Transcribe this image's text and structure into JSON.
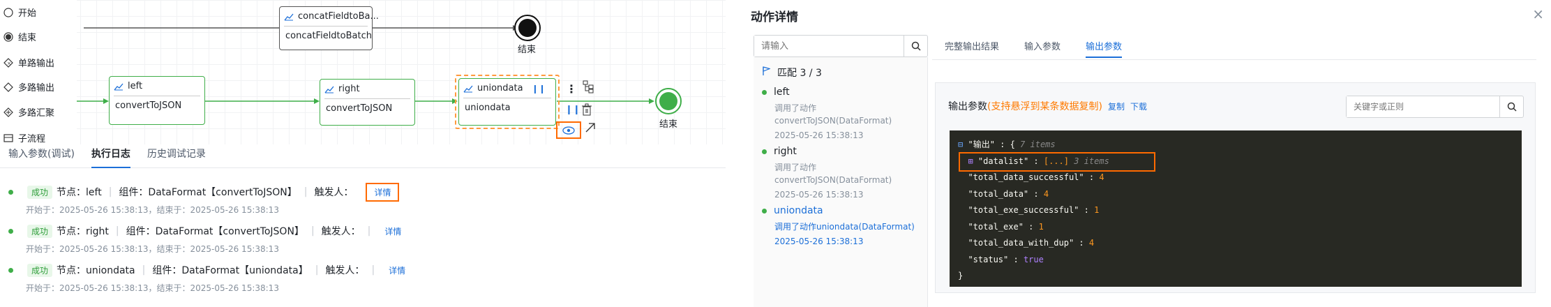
{
  "palette": [
    {
      "label": "开始",
      "icon": "circle-icon"
    },
    {
      "label": "结束",
      "icon": "filled-circle-icon"
    },
    {
      "label": "单路输出",
      "icon": "diamond-icon"
    },
    {
      "label": "多路输出",
      "icon": "diamond-icon"
    },
    {
      "label": "多路汇聚",
      "icon": "diamond-plus-icon"
    },
    {
      "label": "子流程",
      "icon": "subflow-icon"
    }
  ],
  "nodes": {
    "concat": {
      "title": "concatFieldtoBa...",
      "body": "concatFieldtoBatch"
    },
    "left": {
      "title": "left",
      "body": "convertToJSON"
    },
    "right": {
      "title": "right",
      "body": "convertToJSON"
    },
    "uniondata": {
      "title": "uniondata",
      "body": "uniondata"
    }
  },
  "end_labels": [
    "结束",
    "结束"
  ],
  "bottom_tabs": [
    "输入参数(调试)",
    "执行日志",
    "历史调试记录"
  ],
  "logs": [
    {
      "status": "成功",
      "node_label": "节点：",
      "node": "left",
      "comp_label": "组件：",
      "comp": "DataFormat【convertToJSON】",
      "trigger": "触发人：",
      "detail": "详情",
      "start_label": "开始于：",
      "start": "2025-05-26 15:38:13",
      "end_label": "结束于：",
      "end": "2025-05-26 15:38:13"
    },
    {
      "status": "成功",
      "node_label": "节点：",
      "node": "right",
      "comp_label": "组件：",
      "comp": "DataFormat【convertToJSON】",
      "trigger": "触发人：",
      "detail": "详情",
      "start_label": "开始于：",
      "start": "2025-05-26 15:38:13",
      "end_label": "结束于：",
      "end": "2025-05-26 15:38:13"
    },
    {
      "status": "成功",
      "node_label": "节点：",
      "node": "uniondata",
      "comp_label": "组件：",
      "comp": "DataFormat【uniondata】",
      "trigger": "触发人：",
      "detail": "详情",
      "start_label": "开始于：",
      "start": "2025-05-26 15:38:13",
      "end_label": "结束于：",
      "end": "2025-05-26 15:38:13"
    }
  ],
  "panel": {
    "title": "动作详情",
    "close": "×",
    "search_placeholder": "请输入",
    "match": "匹配 3 / 3",
    "items": [
      {
        "name": "left",
        "desc1": "调用了动作",
        "desc2": "convertToJSON(DataFormat)",
        "time": "2025-05-26 15:38:13"
      },
      {
        "name": "right",
        "desc1": "调用了动作",
        "desc2": "convertToJSON(DataFormat)",
        "time": "2025-05-26 15:38:13"
      },
      {
        "name": "uniondata",
        "desc1": "调用了动作uniondata(DataFormat)",
        "desc2": "",
        "time": "2025-05-26 15:38:13"
      }
    ],
    "tabs": [
      "完整输出结果",
      "输入参数",
      "输出参数"
    ],
    "output_title": "输出参数",
    "output_hint": "(支持悬浮到某条数据复制)",
    "copy": "复制",
    "download": "下载",
    "kw_placeholder": "关键字或正则",
    "json": {
      "root_key": "\"输出\"",
      "root_count": "7 items",
      "datalist_key": "\"datalist\"",
      "datalist_val": "[...]",
      "datalist_count": "3 items",
      "rows": [
        {
          "k": "\"total_data_successful\"",
          "v": "4",
          "t": "num"
        },
        {
          "k": "\"total_data\"",
          "v": "4",
          "t": "num"
        },
        {
          "k": "\"total_exe_successful\"",
          "v": "1",
          "t": "num"
        },
        {
          "k": "\"total_exe\"",
          "v": "1",
          "t": "num"
        },
        {
          "k": "\"total_data_with_dup\"",
          "v": "4",
          "t": "num"
        },
        {
          "k": "\"status\"",
          "v": "true",
          "t": "bool"
        }
      ]
    }
  },
  "colors": {
    "accent": "#1c6fd8",
    "success": "#3fae49",
    "highlight": "#ff6a00"
  }
}
